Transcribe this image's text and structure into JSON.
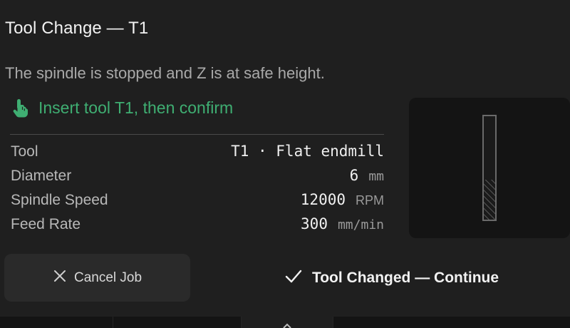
{
  "dialog": {
    "title": "Tool Change — T1",
    "subtitle": "The spindle is stopped and Z is at safe height.",
    "instruction": "Insert tool T1, then confirm",
    "instruction_icon": "hand-pointer-icon",
    "accent_color": "#3fae72"
  },
  "params": [
    {
      "label": "Tool",
      "value": "T1 · Flat endmill",
      "unit": ""
    },
    {
      "label": "Diameter",
      "value": "6",
      "unit": "mm"
    },
    {
      "label": "Spindle Speed",
      "value": "12000",
      "unit": "RPM"
    },
    {
      "label": "Feed Rate",
      "value": "300",
      "unit": "mm/min"
    }
  ],
  "preview": {
    "icon": "endmill-tool-icon"
  },
  "actions": {
    "cancel_label": "Cancel Job",
    "cancel_icon": "close-icon",
    "continue_label": "Tool Changed — Continue",
    "continue_icon": "check-icon"
  },
  "bottom_nav": {
    "icon": "chevron-up-icon"
  }
}
